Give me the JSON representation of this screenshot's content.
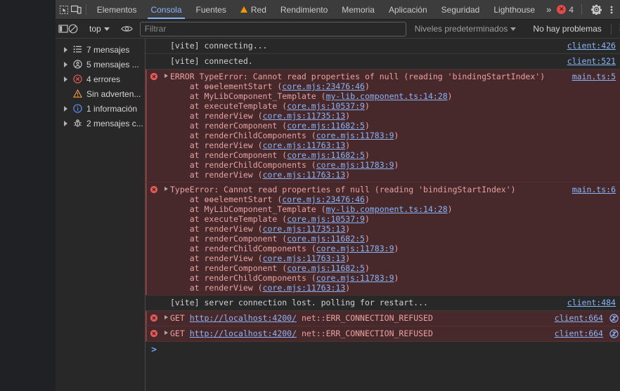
{
  "tabbar": {
    "icons": [
      {
        "name": "inspect-element-icon"
      },
      {
        "name": "device-toolbar-icon"
      }
    ],
    "tabs": [
      {
        "label": "Elementos",
        "active": false,
        "warn": false
      },
      {
        "label": "Consola",
        "active": true,
        "warn": false
      },
      {
        "label": "Fuentes",
        "active": false,
        "warn": false
      },
      {
        "label": "Red",
        "active": false,
        "warn": true
      },
      {
        "label": "Rendimiento",
        "active": false,
        "warn": false
      },
      {
        "label": "Memoria",
        "active": false,
        "warn": false
      },
      {
        "label": "Aplicación",
        "active": false,
        "warn": false
      },
      {
        "label": "Seguridad",
        "active": false,
        "warn": false
      },
      {
        "label": "Lighthouse",
        "active": false,
        "warn": false
      }
    ],
    "more_label": "»",
    "error_count": "4",
    "settings_icon": "gear-icon",
    "menu_icon": "kebab-menu-icon",
    "accent_color": "#8ab4f8",
    "error_color": "#e04b4b"
  },
  "toolbar": {
    "sidebar_toggle": "sidebar-panel-icon",
    "clear_label": "clear-console-icon",
    "context": "top",
    "eye_icon": "live-expression-icon",
    "filter_placeholder": "Filtrar",
    "filter_value": "",
    "levels_label": "Niveles predeterminados",
    "issues_label": "No hay problemas",
    "settings_icon": "console-settings-icon"
  },
  "sidebar": {
    "items": [
      {
        "label": "7 mensajes",
        "icon": "list-icon",
        "arrow": true
      },
      {
        "label": "5 mensajes ...",
        "icon": "user-message-icon",
        "arrow": true
      },
      {
        "label": "4 errores",
        "icon": "error-circle-icon",
        "arrow": true
      },
      {
        "label": "Sin adverten...",
        "icon": "warning-triangle-icon",
        "arrow": false
      },
      {
        "label": "1 información",
        "icon": "info-circle-icon",
        "arrow": true
      },
      {
        "label": "2 mensajes c...",
        "icon": "bug-icon",
        "arrow": true
      }
    ]
  },
  "console": {
    "prompt_symbol": ">",
    "rows": [
      {
        "type": "info",
        "text": "[vite] connecting...",
        "source": "client:426",
        "disclosure": false,
        "req_icon": false
      },
      {
        "type": "info",
        "text": "[vite] connected.",
        "source": "client:521",
        "disclosure": false,
        "req_icon": false
      },
      {
        "type": "error",
        "header": "ERROR TypeError: Cannot read properties of null (reading 'bindingStartIndex')",
        "stack": [
          {
            "fn": "    at ɵɵelementStart (",
            "link": "core.mjs:23476:46",
            "tail": ")"
          },
          {
            "fn": "    at MyLibComponent_Template (",
            "link": "my-lib.component.ts:14:28",
            "tail": ")"
          },
          {
            "fn": "    at executeTemplate (",
            "link": "core.mjs:10537:9",
            "tail": ")"
          },
          {
            "fn": "    at renderView (",
            "link": "core.mjs:11735:13",
            "tail": ")"
          },
          {
            "fn": "    at renderComponent (",
            "link": "core.mjs:11682:5",
            "tail": ")"
          },
          {
            "fn": "    at renderChildComponents (",
            "link": "core.mjs:11783:9",
            "tail": ")"
          },
          {
            "fn": "    at renderView (",
            "link": "core.mjs:11763:13",
            "tail": ")"
          },
          {
            "fn": "    at renderComponent (",
            "link": "core.mjs:11682:5",
            "tail": ")"
          },
          {
            "fn": "    at renderChildComponents (",
            "link": "core.mjs:11783:9",
            "tail": ")"
          },
          {
            "fn": "    at renderView (",
            "link": "core.mjs:11763:13",
            "tail": ")"
          }
        ],
        "source": "main.ts:5",
        "disclosure": true,
        "req_icon": false
      },
      {
        "type": "error",
        "header": "TypeError: Cannot read properties of null (reading 'bindingStartIndex')",
        "stack": [
          {
            "fn": "    at ɵɵelementStart (",
            "link": "core.mjs:23476:46",
            "tail": ")"
          },
          {
            "fn": "    at MyLibComponent_Template (",
            "link": "my-lib.component.ts:14:28",
            "tail": ")"
          },
          {
            "fn": "    at executeTemplate (",
            "link": "core.mjs:10537:9",
            "tail": ")"
          },
          {
            "fn": "    at renderView (",
            "link": "core.mjs:11735:13",
            "tail": ")"
          },
          {
            "fn": "    at renderComponent (",
            "link": "core.mjs:11682:5",
            "tail": ")"
          },
          {
            "fn": "    at renderChildComponents (",
            "link": "core.mjs:11783:9",
            "tail": ")"
          },
          {
            "fn": "    at renderView (",
            "link": "core.mjs:11763:13",
            "tail": ")"
          },
          {
            "fn": "    at renderComponent (",
            "link": "core.mjs:11682:5",
            "tail": ")"
          },
          {
            "fn": "    at renderChildComponents (",
            "link": "core.mjs:11783:9",
            "tail": ")"
          },
          {
            "fn": "    at renderView (",
            "link": "core.mjs:11763:13",
            "tail": ")"
          }
        ],
        "source": "main.ts:6",
        "disclosure": true,
        "req_icon": false
      },
      {
        "type": "info",
        "text": "[vite] server connection lost. polling for restart...",
        "source": "client:484",
        "disclosure": false,
        "req_icon": false
      },
      {
        "type": "error",
        "prefix": "GET ",
        "url": "http://localhost:4200/",
        "suffix": " net::ERR_CONNECTION_REFUSED",
        "source": "client:664",
        "disclosure": true,
        "req_icon": true
      },
      {
        "type": "error",
        "prefix": "GET ",
        "url": "http://localhost:4200/",
        "suffix": " net::ERR_CONNECTION_REFUSED",
        "source": "client:664",
        "disclosure": true,
        "req_icon": true
      }
    ]
  }
}
